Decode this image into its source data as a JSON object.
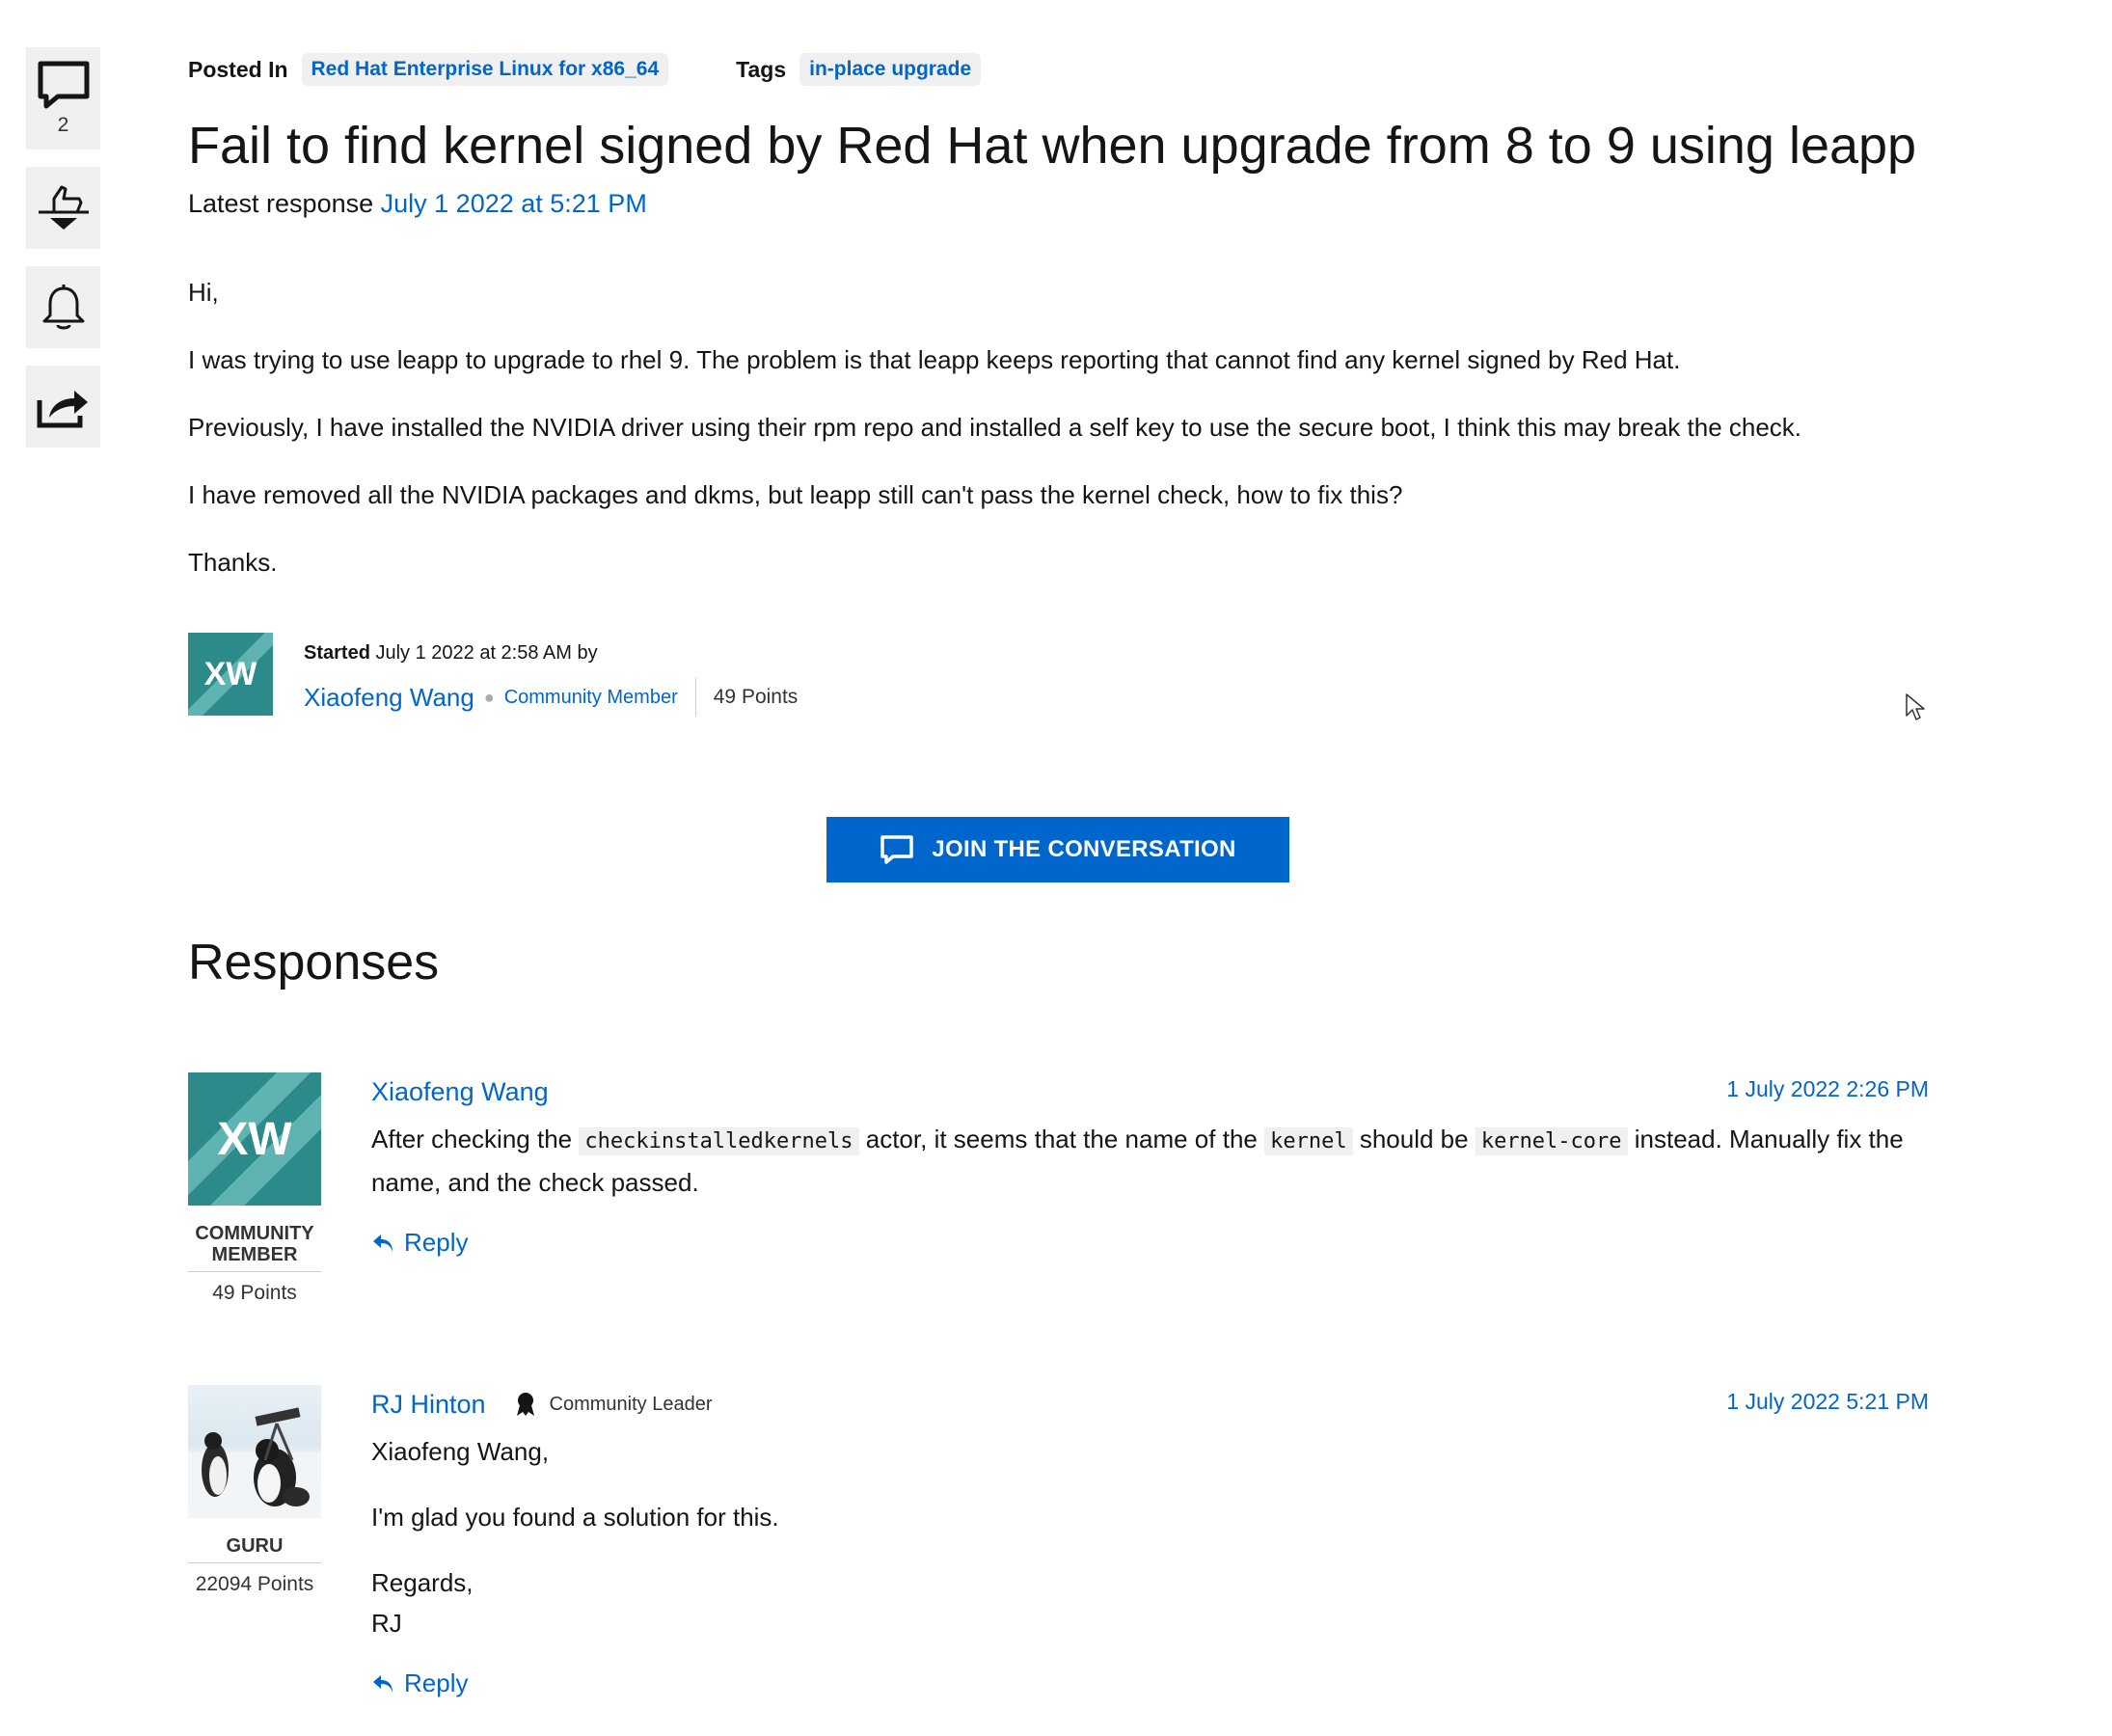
{
  "rail": {
    "comments_count": "2"
  },
  "post": {
    "posted_in_label": "Posted In",
    "posted_in_value": "Red Hat Enterprise Linux for x86_64",
    "tags_label": "Tags",
    "tag": "in-place upgrade",
    "title": "Fail to find kernel signed by Red Hat when upgrade from 8 to 9 using leapp",
    "latest_label": "Latest response",
    "latest_date": "July 1 2022 at 5:21 PM",
    "body": [
      "Hi,",
      "I was trying to use leapp to upgrade to rhel 9. The problem is that leapp keeps reporting that cannot find any kernel signed by Red Hat.",
      "Previously, I have installed the NVIDIA driver using their rpm repo and installed a self key to use the secure boot, I think this may break the check.",
      "I have removed all the NVIDIA packages and dkms, but leapp still can't pass the kernel check, how to fix this?",
      "Thanks."
    ],
    "author": {
      "initials": "XW",
      "started_label": "Started",
      "started_date": "July 1 2022 at 2:58 AM by",
      "name": "Xiaofeng Wang",
      "role": "Community Member",
      "points": "49 Points"
    }
  },
  "join_button": "JOIN THE CONVERSATION",
  "responses_heading": "Responses",
  "responses": [
    {
      "initials": "XW",
      "name": "Xiaofeng Wang",
      "date": "1 July 2022 2:26 PM",
      "role_line1": "COMMUNITY",
      "role_line2": "MEMBER",
      "points": "49 Points",
      "text_1": "After checking the",
      "code_1": "checkinstalledkernels",
      "text_2": "actor, it seems that the name of the",
      "code_2": "kernel",
      "text_3": "should be",
      "code_3": "kernel-core",
      "text_4": "instead. Manually fix the name, and the check passed.",
      "reply": "Reply"
    },
    {
      "name": "RJ Hinton",
      "leader_label": "Community Leader",
      "date": "1 July 2022 5:21 PM",
      "role": "GURU",
      "points": "22094 Points",
      "para_1": "Xiaofeng Wang,",
      "para_2": "I'm glad you found a solution for this.",
      "para_3a": "Regards,",
      "para_3b": "RJ",
      "reply": "Reply"
    }
  ],
  "colors": {
    "link": "#0066cc",
    "button": "#0066cc",
    "chip_bg": "#f0f0f0",
    "avatar_teal": "#2c8a8a"
  },
  "icons": [
    "comment-icon",
    "thumbs-vote-icon",
    "bell-icon",
    "share-icon",
    "reply-arrow-icon",
    "community-leader-icon"
  ]
}
